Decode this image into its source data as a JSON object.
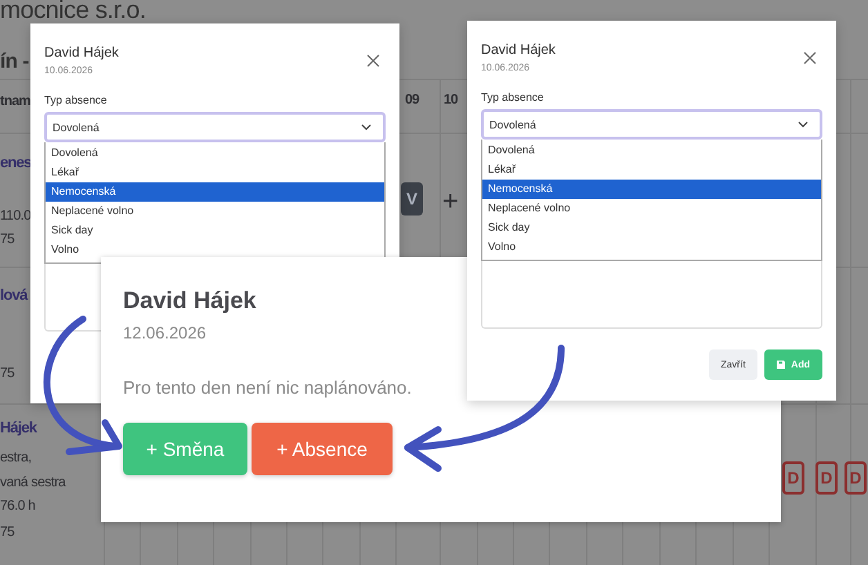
{
  "background": {
    "title": "mocnice s.r.o.",
    "subtitle": "ín -",
    "column_header": "tnam",
    "day_headers": [
      "09",
      "10"
    ],
    "rows": [
      {
        "name": "enes",
        "lines": [
          "110.0",
          "75"
        ]
      },
      {
        "name": "lová",
        "lines": [
          "75"
        ]
      },
      {
        "name": "Hájek",
        "lines": [
          "estra,",
          "vaná sestra",
          "76.0 h",
          "75"
        ]
      }
    ],
    "shift_badge": "V",
    "add_mark": "+",
    "absence_badges": [
      "D",
      "D",
      "D"
    ]
  },
  "dialogs": [
    {
      "title": "David Hájek",
      "date": "10.06.2026",
      "field_label": "Typ absence",
      "field_value": "Dovolená",
      "options": [
        {
          "label": "Dovolená",
          "selected": false
        },
        {
          "label": "Lékař",
          "selected": false
        },
        {
          "label": "Nemocenská",
          "selected": true
        },
        {
          "label": "Neplacené volno",
          "selected": false
        },
        {
          "label": "Sick day",
          "selected": false
        },
        {
          "label": "Volno",
          "selected": false
        }
      ]
    },
    {
      "title": "David Hájek",
      "date": "10.06.2026",
      "field_label": "Typ absence",
      "field_value": "Dovolená",
      "options": [
        {
          "label": "Dovolená",
          "selected": false
        },
        {
          "label": "Lékař",
          "selected": false
        },
        {
          "label": "Nemocenská",
          "selected": true
        },
        {
          "label": "Neplacené volno",
          "selected": false
        },
        {
          "label": "Sick day",
          "selected": false
        },
        {
          "label": "Volno",
          "selected": false
        }
      ],
      "buttons": [
        {
          "label": "Zavřít",
          "kind": "secondary"
        },
        {
          "label": "Add",
          "kind": "primary"
        }
      ]
    }
  ],
  "day_dialog": {
    "title": "David Hájek",
    "date": "12.06.2026",
    "message": "Pro tento den není nic naplánováno.",
    "buttons": [
      {
        "label": "+ Směna",
        "kind": "shift"
      },
      {
        "label": "+ Absence",
        "kind": "absence"
      }
    ]
  }
}
